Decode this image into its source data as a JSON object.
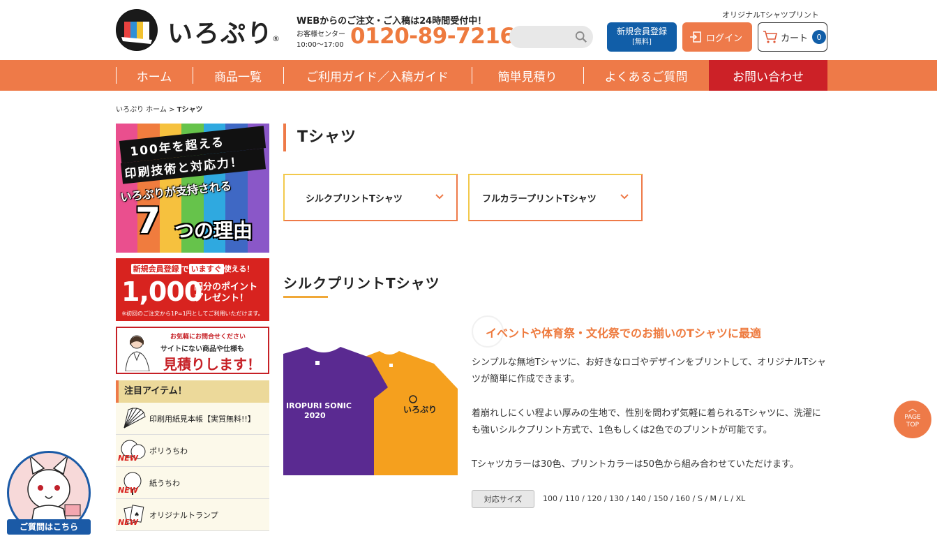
{
  "header": {
    "logo_text": "いろぷり",
    "logo_reg": "®",
    "hours_top": "WEBからのご注文・ご入稿は24時間受付中！",
    "center_label": "お客様センター",
    "center_time": "10:00〜17:00",
    "phone": "0120-89-7216",
    "tagline": "オリジナルTシャツプリント",
    "register_label": "新規会員登録",
    "register_sub": "[無料]",
    "login_label": "ログイン",
    "cart_label": "カート",
    "cart_count": "0"
  },
  "nav": {
    "items": [
      "ホーム",
      "商品一覧",
      "ご利用ガイド／入稿ガイド",
      "簡単見積り",
      "よくあるご質問",
      "お問い合わせ"
    ]
  },
  "breadcrumb": {
    "home": "いろぷり ホーム",
    "sep": " > ",
    "current": "Tシャツ"
  },
  "sidebar": {
    "banner1": {
      "line1": "100年を超える",
      "line2": "印刷技術と対応力！",
      "line3": "いろぷりが支持される",
      "big": "7",
      "line4": "つの理由"
    },
    "banner2": {
      "line1_a": "新規会員登録",
      "line1_b": "で",
      "line1_c": "いますぐ",
      "line1_d": "使える！",
      "big": "1,000",
      "line2": "円分のポイント",
      "line3": "プレゼント！",
      "note": "※初回のご注文から1P=1円としてご利用いただけます。"
    },
    "banner3": {
      "line1": "お気軽にお問合せください",
      "line2": "サイトにない商品や仕様も",
      "line3": "見積りします！"
    },
    "featured_title": "注目アイテム！",
    "items": [
      {
        "label": "印刷用紙見本帳【実質無料!!】",
        "new": ""
      },
      {
        "label": "ポリうちわ",
        "new": "NEW"
      },
      {
        "label": "紙うちわ",
        "new": "NEW"
      },
      {
        "label": "オリジナルトランプ",
        "new": "NEW"
      }
    ]
  },
  "main": {
    "title": "Tシャツ",
    "select_buttons": [
      "シルクプリントTシャツ",
      "フルカラープリントTシャツ"
    ],
    "section_title": "シルクプリントTシャツ",
    "catch": "イベントや体育祭・文化祭でのお揃いのTシャツに最適",
    "desc1": "シンプルな無地Tシャツに、お好きなロゴやデザインをプリントして、オリジナルTシャツが簡単に作成できます。",
    "desc2": "着崩れしにくい程よい厚みの生地で、性別を問わず気軽に着られるTシャツに、洗濯にも強いシルクプリント方式で、1色もしくは2色でのプリントが可能です。",
    "desc3": "Tシャツカラーは30色、プリントカラーは50色から組み合わせていただけます。",
    "size_badge": "対応サイズ",
    "sizes": "100 / 110 / 120 / 130 / 140 / 150 / 160 / S / M / L / XL",
    "shirt_text_1": "IROPURI SONIC",
    "shirt_text_2": "2020",
    "shirt_logo": "いろぷり"
  },
  "pagetop": {
    "arrow": "︿",
    "line1": "PAGE",
    "line2": "TOP"
  },
  "mascot": {
    "label": "ご質問はこちら"
  },
  "colors": {
    "accent": "#ee7a48",
    "brand_blue": "#115ea8",
    "contact_red": "#cc2127",
    "phone_orange": "#ee7a3e"
  }
}
